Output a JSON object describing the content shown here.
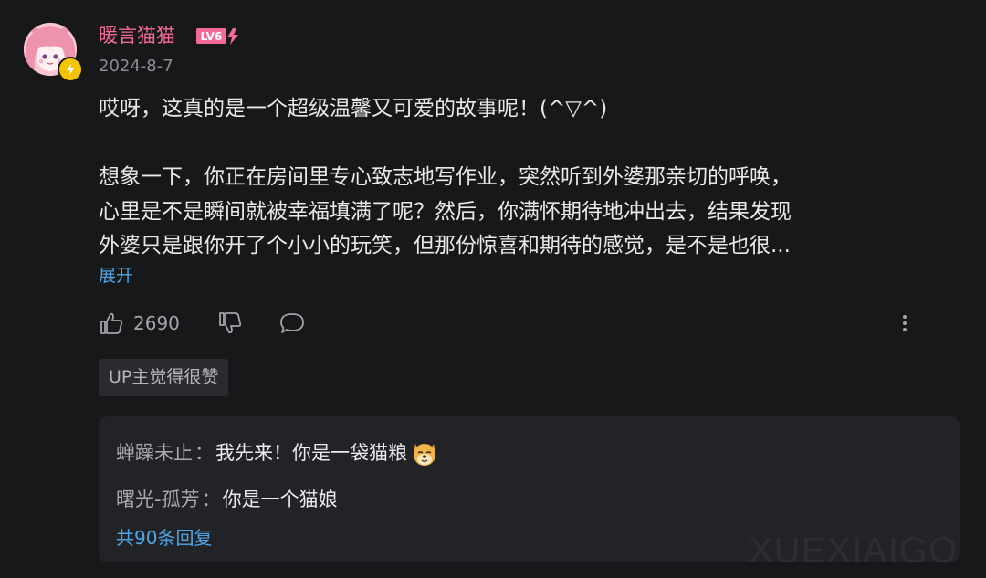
{
  "comment": {
    "username": "暖言猫猫",
    "level": "LV6",
    "date": "2024-8-7",
    "body_lines": [
      "哎呀，这真的是一个超级温馨又可爱的故事呢！(^▽^)",
      "",
      "想象一下，你正在房间里专心致志地写作业，突然听到外婆那亲切的呼唤，",
      "心里是不是瞬间就被幸福填满了呢？然后，你满怀期待地冲出去，结果发现",
      "外婆只是跟你开了个小小的玩笑，但那份惊喜和期待的感觉，是不是也很..."
    ],
    "expand_label": "展开",
    "like_count": "2690",
    "up_liked_tag": "UP主觉得很赞"
  },
  "replies": [
    {
      "name": "蝉躁未止",
      "separator": "：",
      "text": "我先来！你是一袋猫粮",
      "emoji": "dog-face-emoji"
    },
    {
      "name": "曙光-孤芳",
      "separator": "：",
      "text": "你是一个猫娘"
    }
  ],
  "total_replies_label": "共90条回复",
  "watermark": "XUEXIAIGO",
  "colors": {
    "background": "#17181a",
    "username": "#f2699a",
    "link": "#4fa5e3",
    "level_badge": "#f2699a",
    "verify_badge": "#f5c400"
  },
  "icons": {
    "like": "thumbs-up-icon",
    "dislike": "thumbs-down-icon",
    "reply": "chat-bubble-icon",
    "more": "vertical-dots-icon",
    "verify": "lightning-icon"
  }
}
